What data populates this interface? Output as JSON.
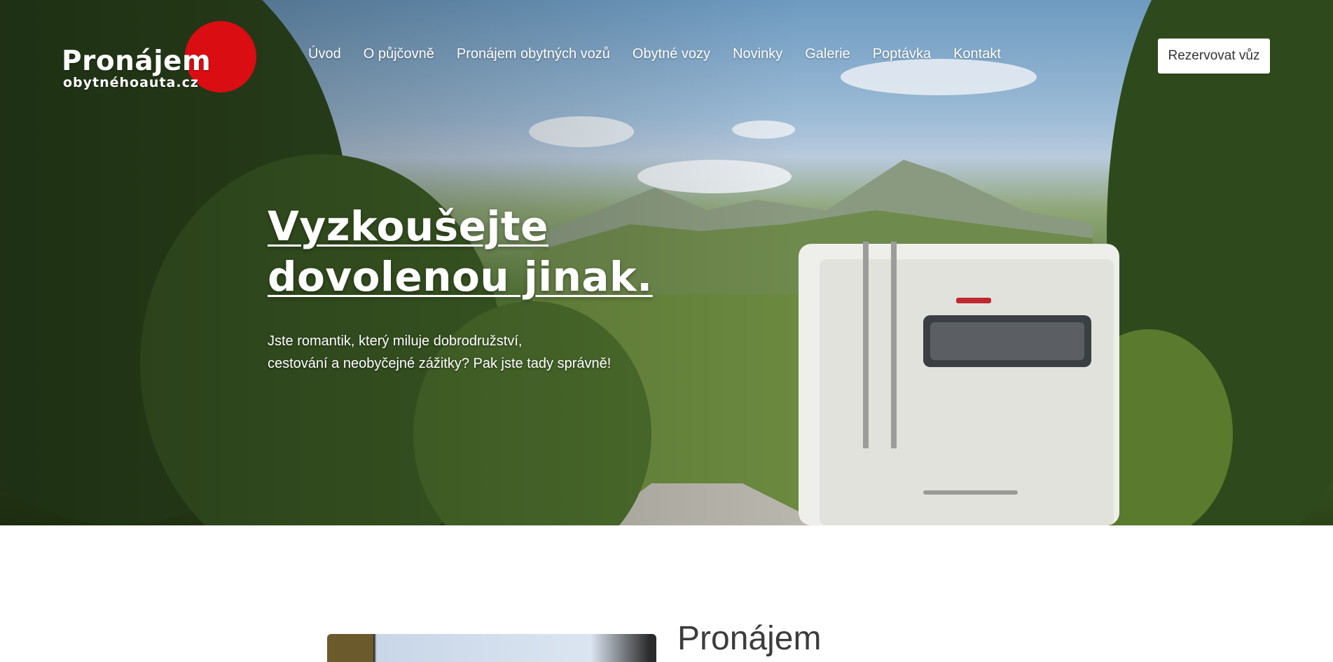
{
  "header": {
    "logo": {
      "title": "Pronájem",
      "subtitle": "obytnéhoauta.cz",
      "brand_color": "#d90d12"
    },
    "nav": [
      {
        "label": "Úvod"
      },
      {
        "label": "O půjčovně"
      },
      {
        "label": "Pronájem obytných vozů"
      },
      {
        "label": "Obytné vozy"
      },
      {
        "label": "Novinky"
      },
      {
        "label": "Galerie"
      },
      {
        "label": "Poptávka"
      },
      {
        "label": "Kontakt"
      }
    ],
    "cta_label": "Rezervovat vůz"
  },
  "hero": {
    "title_line1": "Vyzkoušejte",
    "title_line2": "dovolenou jinak.",
    "subtitle_line1": "Jste romantik, který miluje dobrodružství,",
    "subtitle_line2": "cestování a neobyčejné zážitky? Pak jste tady správně!"
  },
  "section": {
    "heading": "Pronájem"
  }
}
